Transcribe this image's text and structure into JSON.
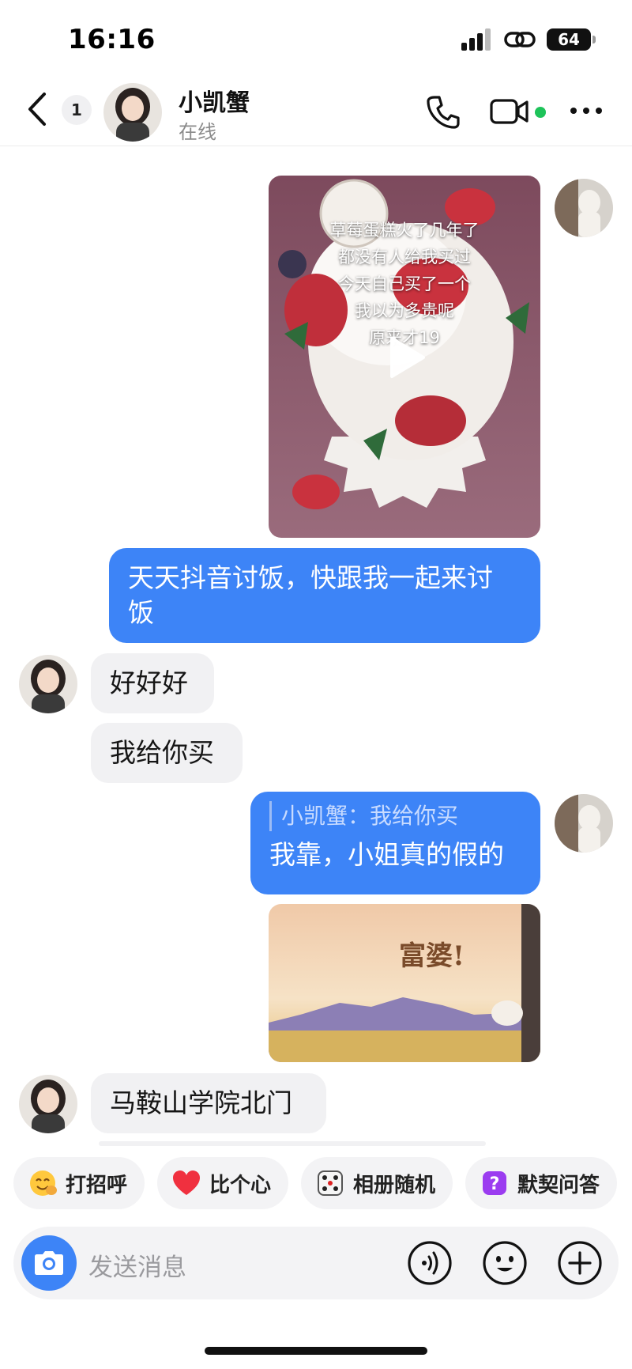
{
  "status_bar": {
    "time": "16:16",
    "battery": "64"
  },
  "header": {
    "unread_count": "1",
    "contact_name": "小凯蟹",
    "contact_status": "在线"
  },
  "messages": {
    "video_caption": [
      "草莓蛋糕火了几年了",
      "都没有人给我买过",
      "今天自己买了一个",
      "我以为多贵呢",
      "原来才19"
    ],
    "msg1_line1": "天天抖音讨饭，快跟我一起来讨",
    "msg1_line2": "饭",
    "msg2": "好好好",
    "msg3": "我给你买",
    "msg4_quote": "小凯蟹：我给你买",
    "msg4": "我靠，小姐真的假的",
    "sticker_text": "富婆!",
    "msg5": "马鞍山学院北门"
  },
  "quick_replies": [
    {
      "label": "打招呼",
      "icon": "wave-emoji-icon"
    },
    {
      "label": "比个心",
      "icon": "heart-icon"
    },
    {
      "label": "相册随机",
      "icon": "dice-icon"
    },
    {
      "label": "默契问答",
      "icon": "question-icon"
    }
  ],
  "input": {
    "placeholder": "发送消息"
  },
  "colors": {
    "accent": "#3d84f7",
    "online": "#1ec35a",
    "bubble_received": "#f1f1f3"
  }
}
